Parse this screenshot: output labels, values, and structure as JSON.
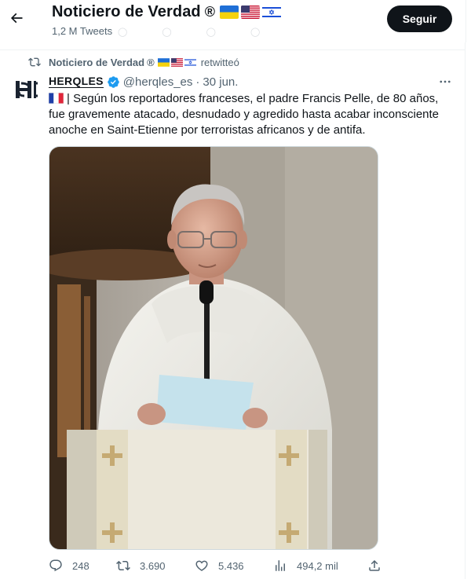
{
  "header": {
    "title": "Noticiero de Verdad",
    "registered_mark": "®",
    "subtitle": "1,2 M Tweets",
    "follow_label": "Seguir",
    "back_icon": "arrow-left-icon",
    "flags": [
      "ukraine-flag",
      "usa-flag",
      "israel-flag"
    ]
  },
  "retweet": {
    "icon": "retweet-icon",
    "name": "Noticiero de Verdad",
    "registered_mark": "®",
    "action": "retwitteó"
  },
  "tweet": {
    "author_name": "HERQLES",
    "verified_icon": "verified-badge-icon",
    "handle": "@herqles_es",
    "separator": "·",
    "date": "30 jun.",
    "lines": [
      "| Según los reportadores franceses, el padre Francis Pelle, de 80 años,",
      "fue gravemente atacado, desnudado y agredido hasta acabar inconsciente",
      "anoche en Saint-Etienne por terroristas africanos y de antifa."
    ],
    "leading_flag": "france-flag",
    "media_description_icon": "photo-priest-at-lectern"
  },
  "actions": {
    "replies": "248",
    "retweets": "3.690",
    "likes": "5.436",
    "views": "494,2 mil"
  },
  "colors": {
    "text_primary": "#0f1419",
    "text_secondary": "#536471",
    "verified_blue": "#1d9bf0",
    "button_bg": "#0f1419"
  }
}
